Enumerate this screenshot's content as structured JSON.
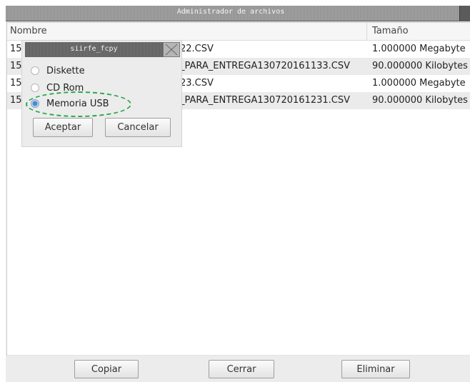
{
  "window": {
    "title": "Administrador de archivos"
  },
  "table": {
    "headers": {
      "name": "Nombre",
      "size": "Tamaño"
    },
    "rows": [
      {
        "name": "15:",
        "name_tail": "22.CSV",
        "size": "1.000000 Megabyte"
      },
      {
        "name": "15:",
        "name_tail": "_PARA_ENTREGA130720161133.CSV",
        "size": "90.000000 Kilobytes"
      },
      {
        "name": "15:",
        "name_tail": "23.CSV",
        "size": "1.000000 Megabyte"
      },
      {
        "name": "15:",
        "name_tail": "_PARA_ENTREGA130720161231.CSV",
        "size": "90.000000 Kilobytes"
      }
    ]
  },
  "buttons": {
    "copy": "Copiar",
    "close": "Cerrar",
    "delete": "Eliminar"
  },
  "dialog": {
    "title": "siirfe_fcpy",
    "options": [
      {
        "label": "Diskette",
        "checked": false
      },
      {
        "label": "CD Rom",
        "checked": false
      },
      {
        "label": "Memoria USB",
        "checked": true
      }
    ],
    "accept": "Aceptar",
    "cancel": "Cancelar"
  },
  "colors": {
    "highlight": "#2aa84a",
    "radio_selected": "#4a8ad0"
  }
}
